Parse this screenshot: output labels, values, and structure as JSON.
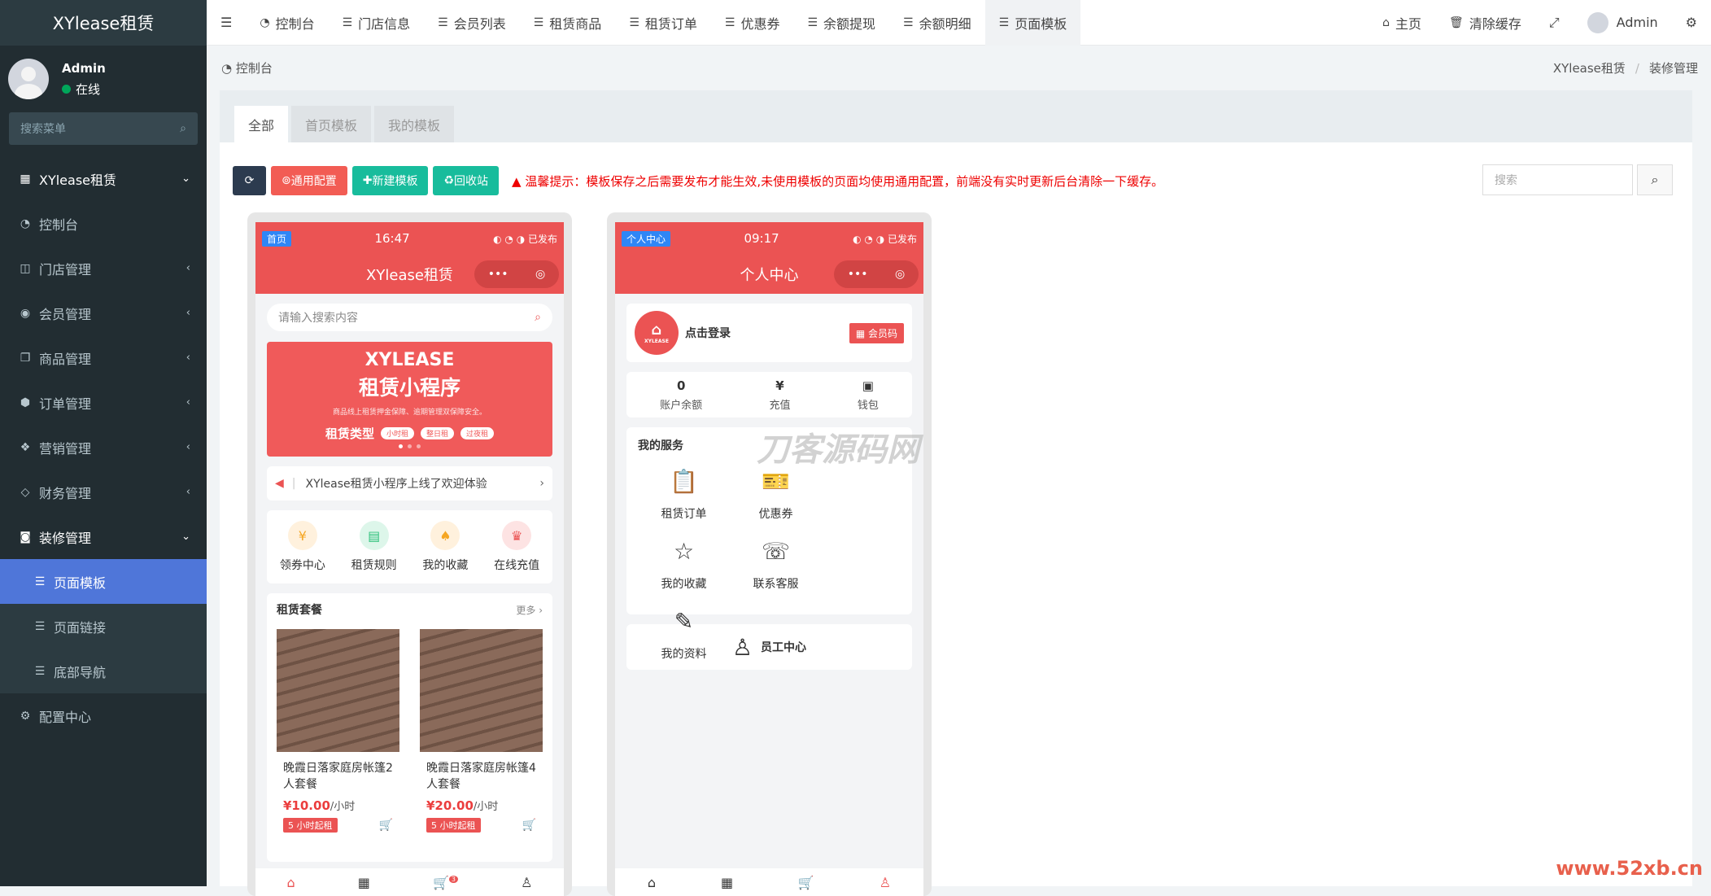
{
  "sidebar": {
    "logo": "XYlease租赁",
    "user_name": "Admin",
    "user_status": "在线",
    "search_placeholder": "搜索菜单",
    "items": [
      {
        "label": "XYlease租赁"
      },
      {
        "label": "控制台"
      },
      {
        "label": "门店管理"
      },
      {
        "label": "会员管理"
      },
      {
        "label": "商品管理"
      },
      {
        "label": "订单管理"
      },
      {
        "label": "营销管理"
      },
      {
        "label": "财务管理"
      },
      {
        "label": "装修管理"
      },
      {
        "label": "页面模板"
      },
      {
        "label": "页面链接"
      },
      {
        "label": "底部导航"
      },
      {
        "label": "配置中心"
      }
    ]
  },
  "topbar": {
    "tabs": [
      "控制台",
      "门店信息",
      "会员列表",
      "租赁商品",
      "租赁订单",
      "优惠券",
      "余额提现",
      "余额明细",
      "页面模板"
    ],
    "home": "主页",
    "clear_cache": "清除缓存",
    "user": "Admin"
  },
  "breadcrumb": {
    "left": "控制台",
    "right_1": "XYlease租赁",
    "right_2": "装修管理"
  },
  "panel": {
    "tabs": [
      "全部",
      "首页模板",
      "我的模板"
    ],
    "btn_general": "通用配置",
    "btn_new": "新建模板",
    "btn_recycle": "回收站",
    "tip": "温馨提示：模板保存之后需要发布才能生效,未使用模板的页面均使用通用配置，前端没有实时更新后台清除一下缓存。",
    "search_placeholder": "搜索"
  },
  "phone1": {
    "badge": "首页",
    "time": "16:47",
    "published": "已发布",
    "title": "XYlease租赁",
    "search_placeholder": "请输入搜索内容",
    "banner_en": "XYLEASE",
    "banner_cn": "租赁小程序",
    "banner_desc": "商品线上租赁押金保障、逾期管理双保障安全。",
    "banner_type": "租赁类型",
    "banner_pills": [
      "小时租",
      "整日租",
      "过夜租"
    ],
    "notice": "XYlease租赁小程序上线了欢迎体验",
    "quick": [
      "领券中心",
      "租赁规则",
      "我的收藏",
      "在线充值"
    ],
    "pkg_title": "租赁套餐",
    "pkg_more": "更多",
    "products": [
      {
        "name": "晚霞日落家庭房帐篷2人套餐",
        "price": "¥10.00",
        "unit": "/小时",
        "tag": "5 小时起租"
      },
      {
        "name": "晚霞日落家庭房帐篷4人套餐",
        "price": "¥20.00",
        "unit": "/小时",
        "tag": "5 小时起租"
      }
    ],
    "cart_count": "3"
  },
  "phone2": {
    "badge": "个人中心",
    "time": "09:17",
    "published": "已发布",
    "title": "个人中心",
    "logo_text": "XYLEASE",
    "login": "点击登录",
    "vip": "会员码",
    "balance_value": "0",
    "balance_label": "账户余额",
    "recharge": "充值",
    "wallet": "钱包",
    "service_title": "我的服务",
    "services": [
      "租赁订单",
      "优惠券",
      "我的收藏",
      "联系客服",
      "我的资料"
    ],
    "staff": "员工中心"
  },
  "watermark": "刀客源码网",
  "corner_watermark": "www.52xb.cn",
  "colors": {
    "accent": "#eb5353",
    "sidebar": "#222d32",
    "active": "#4f76d9",
    "green": "#18bc9c"
  }
}
